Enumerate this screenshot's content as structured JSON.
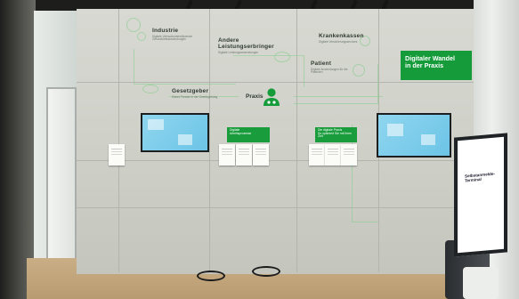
{
  "wall": {
    "industrie": {
      "title": "Industrie",
      "sub": "Digitale Verkaufsunterstützende Gesundheitsanwendungen"
    },
    "leistung": {
      "title": "Andere Leistungserbringer",
      "sub": "Digitale Leistungsanwendungen"
    },
    "krankenkassen": {
      "title": "Krankenkassen",
      "sub": "Digitale Versicherungsservices"
    },
    "patient": {
      "title": "Patient",
      "sub": "Digitale Anwendungen für die Patienten"
    },
    "gesetzgeber": {
      "title": "Gesetzgeber",
      "sub": "Klares Fenster in der Gesetzgebung"
    },
    "praxis": {
      "title": "Praxis"
    },
    "headline": {
      "line1": "Digitaler Wandel",
      "line2": "in der Praxis"
    },
    "card_left": {
      "title": "Digitale",
      "sub": "Arbeitsprozesse"
    },
    "card_right": {
      "title": "Die digitale Praxis",
      "sub": "So optimiert Sie mit Ihren Zeit"
    }
  },
  "terminal": {
    "title": "Selbstanmelde-Terminal"
  },
  "colors": {
    "brand_green": "#159b3a",
    "screen_blue": "#7ccbeb",
    "wall": "#d3d4cc",
    "floor": "#c4a77e"
  }
}
